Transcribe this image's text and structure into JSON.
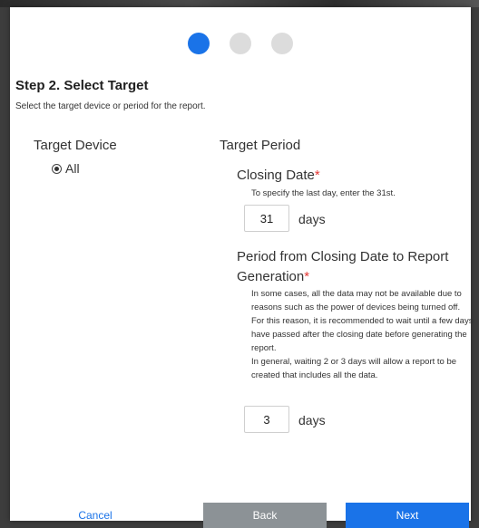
{
  "wizard": {
    "steps": [
      {
        "state": "active"
      },
      {
        "state": "inactive"
      },
      {
        "state": "inactive"
      }
    ],
    "title": "Step 2. Select Target",
    "subtitle": "Select the target device or period for the report."
  },
  "target_device": {
    "heading": "Target Device",
    "option_all": "All",
    "selected": "All"
  },
  "target_period": {
    "heading": "Target Period",
    "closing_date": {
      "label": "Closing Date",
      "required_mark": "*",
      "hint": "To specify the last day, enter the 31st.",
      "value": "31",
      "unit": "days"
    },
    "period_to_generation": {
      "label": "Period from Closing Date to Report Generation",
      "required_mark": "*",
      "help": [
        "In some cases, all the data may not be available due to reasons such as the power of devices being turned off.",
        "For this reason, it is recommended to wait until a few days have passed after the closing date before generating the report.",
        "In general, waiting 2 or 3 days will allow a report to be created that includes all the data."
      ],
      "value": "3",
      "unit": "days"
    }
  },
  "buttons": {
    "cancel": "Cancel",
    "back": "Back",
    "next": "Next"
  },
  "colors": {
    "accent": "#1a73e8",
    "step_inactive": "#dcdcdc",
    "back_button": "#8c9296",
    "required": "#e53935"
  }
}
